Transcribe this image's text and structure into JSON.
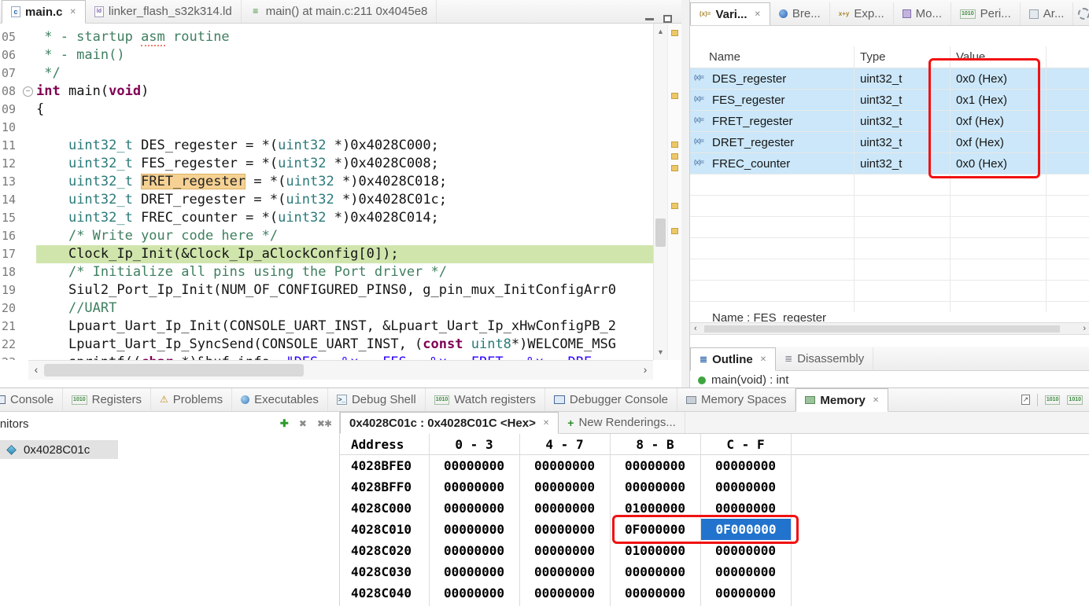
{
  "editor": {
    "tabs": [
      {
        "label": "main.c",
        "icon": "c-file-icon",
        "active": true,
        "closable": true
      },
      {
        "label": "linker_flash_s32k314.ld",
        "icon": "ld-file-icon",
        "active": false,
        "closable": false
      },
      {
        "label": "main() at main.c:211 0x4045e8",
        "icon": "stackframe-icon",
        "active": false,
        "closable": false
      }
    ],
    "current_line": "17",
    "ruler_marker_offsets": [
      8,
      88,
      150,
      165,
      180,
      228,
      260
    ],
    "lines": [
      {
        "num": "05",
        "segs": [
          [
            "c",
            " * - startup "
          ],
          [
            "cm",
            "asm"
          ],
          [
            "c",
            " routine"
          ]
        ]
      },
      {
        "num": "06",
        "segs": [
          [
            "c",
            " * - main()"
          ]
        ]
      },
      {
        "num": "07",
        "segs": [
          [
            "c",
            " */"
          ]
        ]
      },
      {
        "num": "08",
        "fold": true,
        "segs": [
          [
            "k",
            "int"
          ],
          [
            "p",
            " main("
          ],
          [
            "k",
            "void"
          ],
          [
            "p",
            ")"
          ]
        ]
      },
      {
        "num": "09",
        "segs": [
          [
            "p",
            "{"
          ]
        ]
      },
      {
        "num": "10",
        "segs": []
      },
      {
        "num": "11",
        "segs": [
          [
            "p",
            "    "
          ],
          [
            "t",
            "uint32_t"
          ],
          [
            "p",
            " DES_regester = *("
          ],
          [
            "t",
            "uint32"
          ],
          [
            "p",
            " *)0x4028C000;"
          ]
        ]
      },
      {
        "num": "12",
        "segs": [
          [
            "p",
            "    "
          ],
          [
            "t",
            "uint32_t"
          ],
          [
            "p",
            " FES_regester = *("
          ],
          [
            "t",
            "uint32"
          ],
          [
            "p",
            " *)0x4028C008;"
          ]
        ]
      },
      {
        "num": "13",
        "segs": [
          [
            "p",
            "    "
          ],
          [
            "t",
            "uint32_t"
          ],
          [
            "p",
            " "
          ],
          [
            "o",
            "FRET_regester"
          ],
          [
            "p",
            " = *("
          ],
          [
            "t",
            "uint32"
          ],
          [
            "p",
            " *)0x4028C018;"
          ]
        ]
      },
      {
        "num": "14",
        "segs": [
          [
            "p",
            "    "
          ],
          [
            "t",
            "uint32_t"
          ],
          [
            "p",
            " DRET_regester = *("
          ],
          [
            "t",
            "uint32"
          ],
          [
            "p",
            " *)0x4028C01c;"
          ]
        ]
      },
      {
        "num": "15",
        "segs": [
          [
            "p",
            "    "
          ],
          [
            "t",
            "uint32_t"
          ],
          [
            "p",
            " FREC_counter = *("
          ],
          [
            "t",
            "uint32"
          ],
          [
            "p",
            " *)0x4028C014;"
          ]
        ]
      },
      {
        "num": "16",
        "segs": [
          [
            "p",
            "    "
          ],
          [
            "c",
            "/* Write your code here */"
          ]
        ]
      },
      {
        "num": "17",
        "segs": [
          [
            "p",
            "    "
          ],
          [
            "p",
            "Clock_Ip_Init(&Clock_Ip_aClockConfig[0]);"
          ]
        ]
      },
      {
        "num": "18",
        "segs": [
          [
            "p",
            "    "
          ],
          [
            "c",
            "/* Initialize all pins using the Port driver */"
          ]
        ]
      },
      {
        "num": "19",
        "segs": [
          [
            "p",
            "    "
          ],
          [
            "p",
            "Siul2_Port_Ip_Init(NUM_OF_CONFIGURED_PINS0, g_pin_mux_InitConfigArr0"
          ]
        ]
      },
      {
        "num": "20",
        "segs": [
          [
            "p",
            "    "
          ],
          [
            "c",
            "//UART"
          ]
        ]
      },
      {
        "num": "21",
        "segs": [
          [
            "p",
            "    "
          ],
          [
            "p",
            "Lpuart_Uart_Ip_Init(CONSOLE_UART_INST, &Lpuart_Uart_Ip_xHwConfigPB_2"
          ]
        ]
      },
      {
        "num": "22",
        "segs": [
          [
            "p",
            "    "
          ],
          [
            "p",
            "Lpuart_Uart_Ip_SyncSend(CONSOLE_UART_INST, ("
          ],
          [
            "k",
            "const"
          ],
          [
            "p",
            " "
          ],
          [
            "t",
            "uint8"
          ],
          [
            "p",
            "*)WELCOME_MSG"
          ]
        ]
      },
      {
        "num": "23",
        "segs": [
          [
            "p",
            "    "
          ],
          [
            "p",
            "sprintf(("
          ],
          [
            "k",
            "char"
          ],
          [
            "p",
            " *)&buf_info, "
          ],
          [
            "s",
            "\"DES = %x,  FES = %x,  FRET = %x,  DRE"
          ]
        ]
      }
    ]
  },
  "variables": {
    "tabs": [
      {
        "label": "Vari...",
        "icon": "variables-icon",
        "active": true,
        "closable": true
      },
      {
        "label": "Bre...",
        "icon": "breakpoints-icon"
      },
      {
        "label": "Exp...",
        "icon": "expressions-icon"
      },
      {
        "label": "Mo...",
        "icon": "modules-icon"
      },
      {
        "label": "Peri...",
        "icon": "peripherals-icon"
      },
      {
        "label": "Ar...",
        "icon": "ar-icon"
      }
    ],
    "columns": [
      "Name",
      "Type",
      "Value"
    ],
    "rows": [
      {
        "name": "DES_regester",
        "type": "uint32_t",
        "value": "0x0 (Hex)"
      },
      {
        "name": "FES_regester",
        "type": "uint32_t",
        "value": "0x1 (Hex)"
      },
      {
        "name": "FRET_regester",
        "type": "uint32_t",
        "value": "0xf (Hex)"
      },
      {
        "name": "DRET_regester",
        "type": "uint32_t",
        "value": "0xf (Hex)"
      },
      {
        "name": "FREC_counter",
        "type": "uint32_t",
        "value": "0x0 (Hex)"
      }
    ],
    "detail_text": "Name : FES_regester"
  },
  "outline": {
    "tabs": [
      {
        "label": "Outline",
        "icon": "outline-icon",
        "active": true,
        "closable": true
      },
      {
        "label": "Disassembly",
        "icon": "disassembly-icon"
      }
    ],
    "clipped_item": "main(void) : int"
  },
  "bottom": {
    "tabs": [
      {
        "label": "Console",
        "icon": "console-icon"
      },
      {
        "label": "Registers",
        "icon": "registers-icon"
      },
      {
        "label": "Problems",
        "icon": "problems-icon"
      },
      {
        "label": "Executables",
        "icon": "executables-icon"
      },
      {
        "label": "Debug Shell",
        "icon": "debug-shell-icon"
      },
      {
        "label": "Watch registers",
        "icon": "watch-registers-icon"
      },
      {
        "label": "Debugger Console",
        "icon": "debugger-console-icon"
      },
      {
        "label": "Memory Spaces",
        "icon": "memory-spaces-icon"
      },
      {
        "label": "Memory",
        "icon": "memory-icon",
        "active": true,
        "closable": true
      }
    ],
    "monitors": {
      "title": "Monitors",
      "items": [
        "0x4028C01c"
      ]
    },
    "memory": {
      "tabs": [
        {
          "label": "0x4028C01c : 0x4028C01C <Hex>",
          "active": true,
          "closable": true
        },
        {
          "label": "New Renderings...",
          "plus": true
        }
      ],
      "columns": [
        "Address",
        "0 - 3",
        "4 - 7",
        "8 - B",
        "C - F"
      ],
      "rows": [
        [
          "4028BFE0",
          "00000000",
          "00000000",
          "00000000",
          "00000000"
        ],
        [
          "4028BFF0",
          "00000000",
          "00000000",
          "00000000",
          "00000000"
        ],
        [
          "4028C000",
          "00000000",
          "00000000",
          "01000000",
          "00000000"
        ],
        [
          "4028C010",
          "00000000",
          "00000000",
          "0F000000",
          "0F000000"
        ],
        [
          "4028C020",
          "00000000",
          "00000000",
          "01000000",
          "00000000"
        ],
        [
          "4028C030",
          "00000000",
          "00000000",
          "00000000",
          "00000000"
        ],
        [
          "4028C040",
          "00000000",
          "00000000",
          "00000000",
          "00000000"
        ]
      ],
      "selected": {
        "row": 3,
        "col": 4
      }
    },
    "annotation_color": "#f11212"
  }
}
